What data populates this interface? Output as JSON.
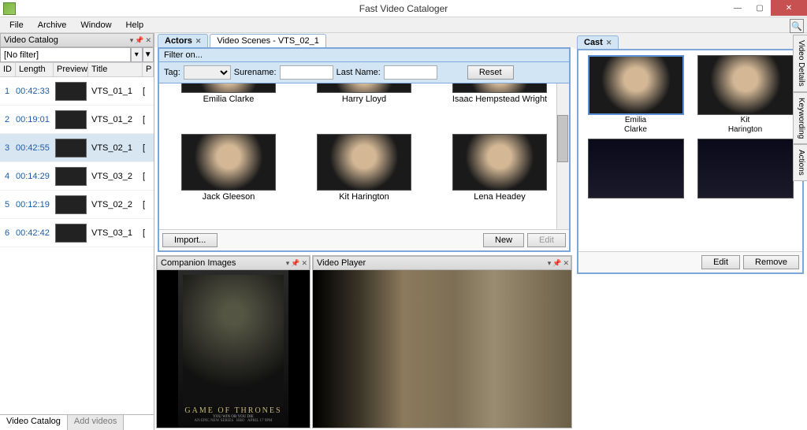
{
  "app_title": "Fast Video Cataloger",
  "menu": [
    "File",
    "Archive",
    "Window",
    "Help"
  ],
  "left": {
    "panel_title": "Video Catalog",
    "filter_value": "[No filter]",
    "cols": {
      "id": "ID",
      "length": "Length",
      "preview": "Preview",
      "title": "Title",
      "p": "P"
    },
    "rows": [
      {
        "id": "1",
        "len": "00:42:33",
        "title": "VTS_01_1",
        "p": "[",
        "thumb": "snowy"
      },
      {
        "id": "2",
        "len": "00:19:01",
        "title": "VTS_01_2",
        "p": "[",
        "thumb": "interior"
      },
      {
        "id": "3",
        "len": "00:42:55",
        "title": "VTS_02_1",
        "p": "[",
        "thumb": "interior",
        "sel": true
      },
      {
        "id": "4",
        "len": "00:14:29",
        "title": "VTS_03_2",
        "p": "[",
        "thumb": "dark"
      },
      {
        "id": "5",
        "len": "00:12:19",
        "title": "VTS_02_2",
        "p": "[",
        "thumb": "brown"
      },
      {
        "id": "6",
        "len": "00:42:42",
        "title": "VTS_03_1",
        "p": "[",
        "thumb": "brown"
      }
    ],
    "bottom_tabs": {
      "catalog": "Video Catalog",
      "add": "Add videos"
    }
  },
  "tabs": {
    "actors": "Actors",
    "scenes": "Video Scenes - VTS_02_1"
  },
  "actors_panel": {
    "filter_on": "Filter on...",
    "tag": "Tag:",
    "surename": "Surename:",
    "lastname": "Last Name:",
    "reset": "Reset",
    "actors": [
      {
        "name": "Emilia Clarke"
      },
      {
        "name": "Harry Lloyd"
      },
      {
        "name": "Isaac Hempstead Wright"
      },
      {
        "name": "Jack Gleeson"
      },
      {
        "name": "Kit Harington"
      },
      {
        "name": "Lena Headey"
      }
    ],
    "import": "Import...",
    "new": "New",
    "edit": "Edit"
  },
  "companion": {
    "title": "Companion Images",
    "poster_title": "GAME OF THRONES",
    "poster_sub": "YOU WIN OR YOU DIE"
  },
  "player": {
    "title": "Video Player"
  },
  "cast": {
    "tab": "Cast",
    "items": [
      {
        "first": "Emilia",
        "last": "Clarke",
        "sel": true
      },
      {
        "first": "Kit",
        "last": "Harington"
      },
      {
        "first": "",
        "last": ""
      },
      {
        "first": "",
        "last": ""
      }
    ],
    "edit": "Edit",
    "remove": "Remove"
  },
  "side_tabs": [
    "Video Details",
    "Keywording",
    "Actions"
  ]
}
